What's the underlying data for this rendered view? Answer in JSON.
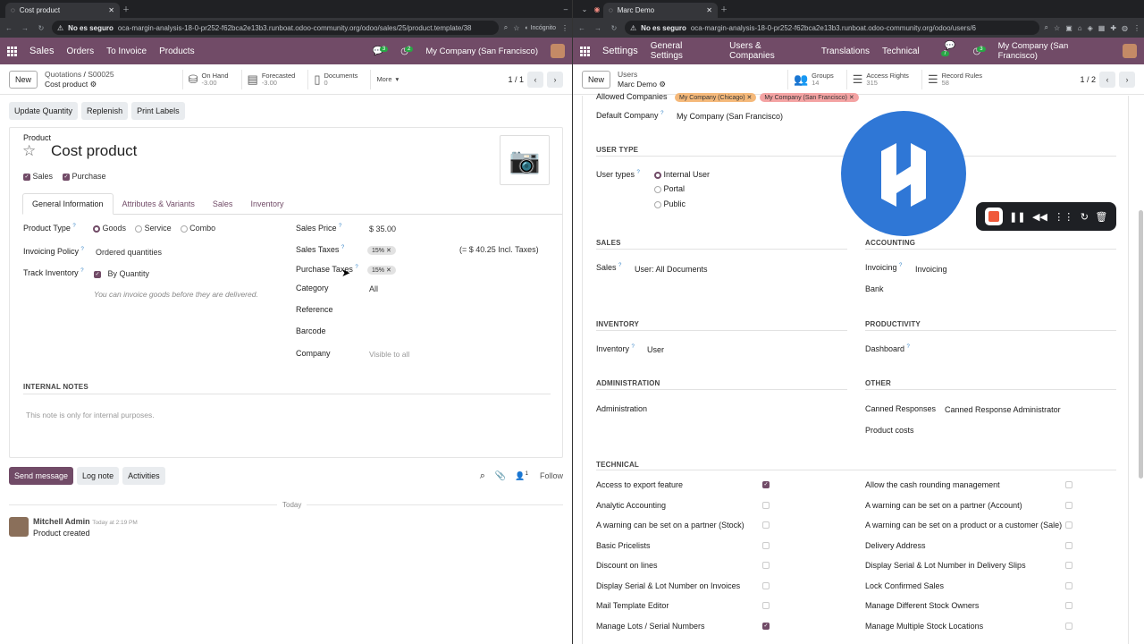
{
  "left": {
    "tab_title": "Cost product",
    "url_warning": "No es seguro",
    "url": "oca-margin-analysis-18-0-pr252-f62bca2e13b3.runboat.odoo-community.org/odoo/sales/25/product.template/38",
    "incognito": "Incógnito",
    "nav": {
      "app": "Sales",
      "items": [
        "Orders",
        "To Invoice",
        "Products"
      ],
      "msg_badge": "3",
      "act_badge": "2",
      "company": "My Company (San Francisco)"
    },
    "cp": {
      "new": "New",
      "bc_parent": "Quotations",
      "bc_sep": "/",
      "bc_parent2": "S00025",
      "bc_current": "Cost product",
      "on_hand_label": "On Hand",
      "on_hand_val": "-3.00",
      "forecast_label": "Forecasted",
      "forecast_val": "-3.00",
      "docs_label": "Documents",
      "docs_val": "0",
      "more": "More",
      "pager": "1 / 1"
    },
    "actions": [
      "Update Quantity",
      "Replenish",
      "Print Labels"
    ],
    "form": {
      "product_label": "Product",
      "name": "Cost product",
      "sales": "Sales",
      "purchase": "Purchase",
      "tabs": [
        "General Information",
        "Attributes & Variants",
        "Sales",
        "Inventory"
      ],
      "product_type_label": "Product Type",
      "types": [
        "Goods",
        "Service",
        "Combo"
      ],
      "invoicing_policy_label": "Invoicing Policy",
      "invoicing_policy": "Ordered quantities",
      "track_label": "Track Inventory",
      "track_val": "By Quantity",
      "note": "You can invoice goods before they are delivered.",
      "sales_price_label": "Sales Price",
      "sales_price": "$ 35.00",
      "sales_taxes_label": "Sales Taxes",
      "sales_tax": "15%",
      "incl": "(= $ 40.25 Incl. Taxes)",
      "purchase_taxes_label": "Purchase Taxes",
      "purchase_tax": "15%",
      "category_label": "Category",
      "category": "All",
      "reference_label": "Reference",
      "barcode_label": "Barcode",
      "company_label": "Company",
      "company_ph": "Visible to all",
      "internal_notes": "INTERNAL NOTES",
      "notes_ph": "This note is only for internal purposes."
    },
    "chatter": {
      "send": "Send message",
      "log": "Log note",
      "activities": "Activities",
      "followers": "1",
      "follow": "Follow",
      "today": "Today",
      "author": "Mitchell Admin",
      "time": "Today at 2:19 PM",
      "body": "Product created"
    }
  },
  "right": {
    "tab_title": "Marc Demo",
    "url_warning": "No es seguro",
    "url": "oca-margin-analysis-18-0-pr252-f62bca2e13b3.runboat.odoo-community.org/odoo/users/6",
    "nav": {
      "app": "Settings",
      "items": [
        "General Settings",
        "Users & Companies",
        "Translations",
        "Technical"
      ],
      "msg_badge": "7",
      "act_badge": "3",
      "company": "My Company (San Francisco)"
    },
    "cp": {
      "new": "New",
      "bc_parent": "Users",
      "bc_current": "Marc Demo",
      "groups_label": "Groups",
      "groups_val": "14",
      "access_label": "Access Rights",
      "access_val": "315",
      "rules_label": "Record Rules",
      "rules_val": "58",
      "pager": "1 / 2"
    },
    "form": {
      "allowed_label": "Allowed Companies",
      "allowed": [
        "My Company (Chicago)",
        "My Company (San Francisco)"
      ],
      "default_company_label": "Default Company",
      "default_company": "My Company (San Francisco)",
      "user_type_hd": "USER TYPE",
      "user_types_label": "User types",
      "user_types": [
        "Internal User",
        "Portal",
        "Public"
      ],
      "sales_hd": "SALES",
      "sales_label": "Sales",
      "sales_val": "User: All Documents",
      "accounting_hd": "ACCOUNTING",
      "invoicing_label": "Invoicing",
      "invoicing_val": "Invoicing",
      "bank": "Bank",
      "inventory_hd": "INVENTORY",
      "inventory_label": "Inventory",
      "inventory_val": "User",
      "productivity_hd": "PRODUCTIVITY",
      "dashboard_label": "Dashboard",
      "admin_hd": "ADMINISTRATION",
      "admin_label": "Administration",
      "other_hd": "OTHER",
      "canned_label": "Canned Responses",
      "canned_val": "Canned Response Administrator",
      "product_costs": "Product costs",
      "technical_hd": "TECHNICAL",
      "tech_left": [
        {
          "label": "Access to export feature",
          "on": true
        },
        {
          "label": "Analytic Accounting",
          "on": false
        },
        {
          "label": "A warning can be set on a partner (Stock)",
          "on": false
        },
        {
          "label": "Basic Pricelists",
          "on": false
        },
        {
          "label": "Discount on lines",
          "on": false
        },
        {
          "label": "Display Serial & Lot Number on Invoices",
          "on": false
        },
        {
          "label": "Mail Template Editor",
          "on": false
        },
        {
          "label": "Manage Lots / Serial Numbers",
          "on": true
        }
      ],
      "tech_right": [
        {
          "label": "Allow the cash rounding management",
          "on": false
        },
        {
          "label": "A warning can be set on a partner (Account)",
          "on": false
        },
        {
          "label": "A warning can be set on a product or a customer (Sale)",
          "on": false
        },
        {
          "label": "Delivery Address",
          "on": false
        },
        {
          "label": "Display Serial & Lot Number in Delivery Slips",
          "on": false
        },
        {
          "label": "Lock Confirmed Sales",
          "on": false
        },
        {
          "label": "Manage Different Stock Owners",
          "on": false
        },
        {
          "label": "Manage Multiple Stock Locations",
          "on": false
        }
      ]
    }
  },
  "colors": {
    "brand": "#714b67",
    "recorder_stop": "#f0593a",
    "logo_blue": "#2f77d6"
  }
}
